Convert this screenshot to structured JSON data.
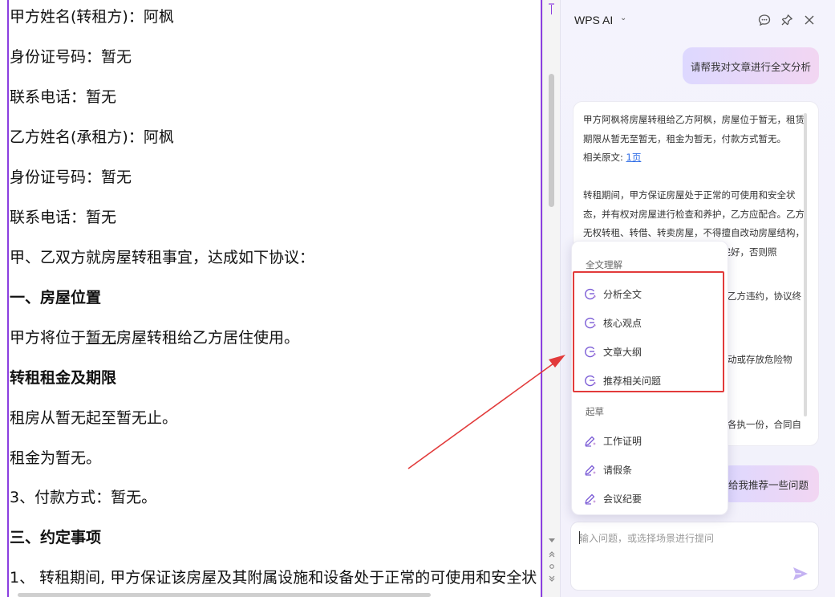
{
  "document": {
    "lines": [
      {
        "text": "甲方姓名(转租方)：阿枫",
        "bold": false
      },
      {
        "text": "身份证号码：暂无",
        "bold": false
      },
      {
        "text": "联系电话：暂无",
        "bold": false
      },
      {
        "text": "乙方姓名(承租方)：阿枫",
        "bold": false
      },
      {
        "text": "身份证号码：暂无",
        "bold": false
      },
      {
        "text": "联系电话：暂无",
        "bold": false
      },
      {
        "text": "甲、乙双方就房屋转租事宜，达成如下协议：",
        "bold": false
      },
      {
        "text": "一、房屋位置",
        "bold": true
      },
      {
        "pre": "甲方将位于",
        "underlined": "暂无",
        "post": "房屋转租给乙方居住使用。"
      },
      {
        "text": "转租租金及期限",
        "bold": true
      },
      {
        "text": "租房从暂无起至暂无止。",
        "bold": false
      },
      {
        "text": "租金为暂无。",
        "bold": false
      },
      {
        "text": "3、付款方式：暂无。",
        "bold": false
      },
      {
        "text": "三、约定事项",
        "bold": true
      },
      {
        "text": "1、 转租期间, 甲方保证该房屋及其附属设施和设备处于正常的可使用和安全状",
        "bold": false
      }
    ]
  },
  "ai_panel": {
    "title": "WPS AI",
    "title_caret": "⌄",
    "header_icons": [
      "chat-bubble-icon",
      "pin-icon",
      "close-icon"
    ],
    "user_message": "请帮我对文章进行全文分析",
    "answer": {
      "para1": "甲方阿枫将房屋转租给乙方阿枫，房屋位于暂无，租赁期限从暂无至暂无，租金为暂无，付款方式暂无。",
      "source_label": "相关原文: ",
      "source_link": "1页",
      "para2": "转租期间，甲方保证房屋处于正常的可使用和安全状态，并有权对房屋进行检查和养护，乙方应配合。乙方无权转租、转借、转卖房屋，不得擅自改动房屋结构，应爱护屋内设施，如有损坏需维修完好，否则照",
      "frag1": "乙方违约，协议终",
      "frag2": "动或存放危险物",
      "frag3": "各执一份，合同自"
    },
    "user_message2": "给我推荐一些问题",
    "input_placeholder": "输入问题，或选择场景进行提问",
    "send_icon": "send-icon"
  },
  "menu": {
    "section1": "全文理解",
    "items1": [
      "分析全文",
      "核心观点",
      "文章大纲",
      "推荐相关问题"
    ],
    "items1_icon": "ai-spark-icon",
    "section2": "起草",
    "items2": [
      "工作证明",
      "请假条",
      "会议纪要"
    ],
    "items2_icon": "pen-sparkle-icon"
  },
  "colors": {
    "accent_purple": "#8b3fe0",
    "annotation_red": "#e23b3b",
    "link_blue": "#2e6ce6"
  }
}
